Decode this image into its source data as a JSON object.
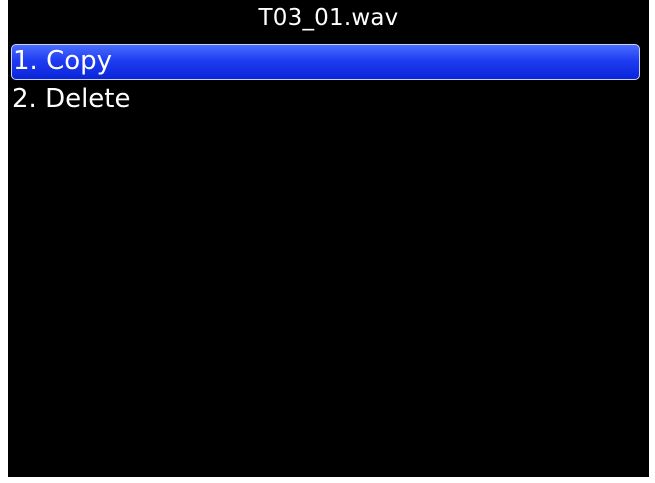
{
  "screen": {
    "title": "T03_01.wav"
  },
  "menu": {
    "items": [
      {
        "label": "1. Copy",
        "selected": true
      },
      {
        "label": "2. Delete",
        "selected": false
      }
    ]
  },
  "colors": {
    "background": "#000000",
    "text": "#ffffff",
    "highlight": "#1f3df2",
    "highlight_border": "#c8d2ff"
  }
}
